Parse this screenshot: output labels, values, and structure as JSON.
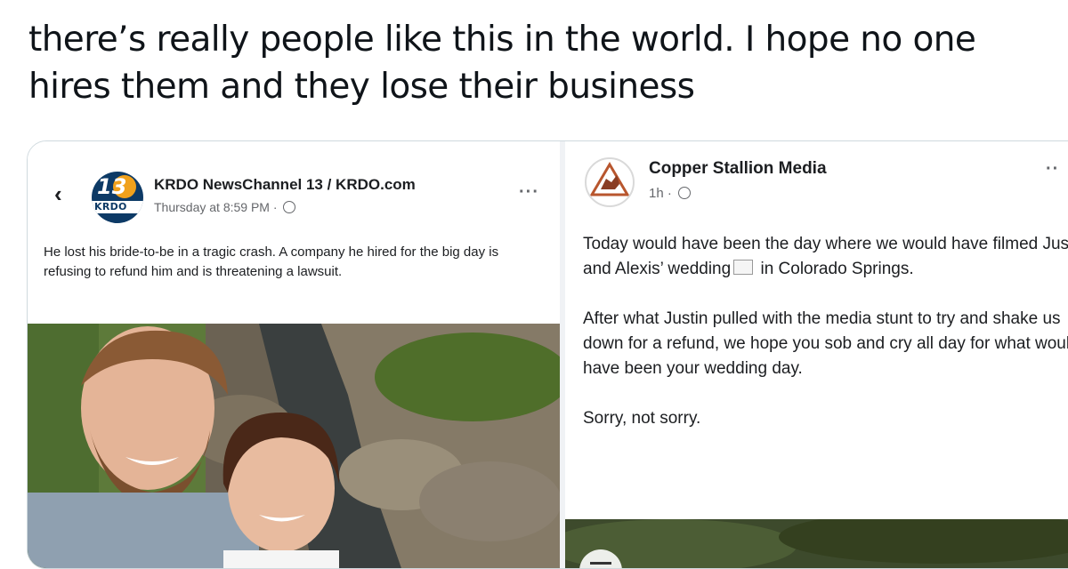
{
  "tweet": {
    "line1": "there’s really people like this in the world. I hope no one",
    "line2": "hires them and they lose their business"
  },
  "left_post": {
    "back_glyph": "‹",
    "logo_number": "13",
    "logo_brand": "KRDO",
    "page_name": "KRDO NewsChannel 13 / KRDO.com",
    "meta": "Thursday at 8:59 PM · ",
    "more": "···",
    "body": "He lost his bride-to-be in a tragic crash. A company he hired for the big day is refusing to refund him and is threatening a lawsuit."
  },
  "right_post": {
    "page_name": "Copper Stallion Media",
    "meta": "1h · ",
    "more": "··",
    "p1_before": "Today would have been the day where we would have filmed Justin and Alexis’ wedding",
    "p1_after": " in Colorado Springs.",
    "p2": "After what Justin pulled with the media stunt to try and shake us down for a refund, we hope you sob and cry all day for what would have been your wedding day.",
    "p3": "Sorry, not sorry."
  },
  "colors": {
    "text": "#0f1419",
    "fb_text": "#1c1e21",
    "fb_meta": "#65676b",
    "border": "#cfd9de",
    "krdo_blue": "#0d3a66",
    "krdo_orange": "#f0a11c"
  },
  "icons": [
    "back-chevron-icon",
    "globe-icon",
    "more-options-icon",
    "krdo-logo",
    "copper-stallion-logo",
    "menu-icon"
  ]
}
